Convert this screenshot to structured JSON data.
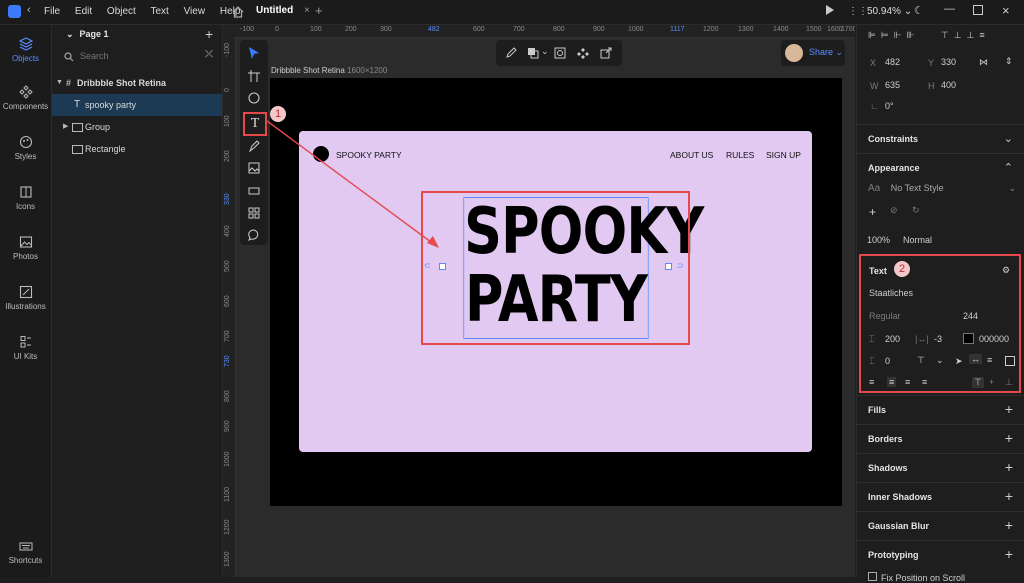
{
  "titlebar": {
    "menus": [
      "File",
      "Edit",
      "Object",
      "Text",
      "View",
      "Help"
    ],
    "tab_title": "Untitled",
    "zoom": "50.94%"
  },
  "rail": {
    "items": [
      {
        "label": "Objects",
        "icon": "layers-icon"
      },
      {
        "label": "Components",
        "icon": "components-icon"
      },
      {
        "label": "Styles",
        "icon": "styles-icon"
      },
      {
        "label": "Icons",
        "icon": "icons-icon"
      },
      {
        "label": "Photos",
        "icon": "photos-icon"
      },
      {
        "label": "Illustrations",
        "icon": "illustrations-icon"
      },
      {
        "label": "UI Kits",
        "icon": "ui-kits-icon"
      }
    ],
    "shortcuts_label": "Shortcuts"
  },
  "layers": {
    "page": "Page 1",
    "search_placeholder": "Search",
    "items": [
      "Dribbble Shot Retina",
      "spooky party",
      "Group",
      "Rectangle"
    ]
  },
  "canvas": {
    "ruler_top": [
      "-100",
      "0",
      "100",
      "200",
      "300",
      "482",
      "600",
      "700",
      "800",
      "900",
      "1000",
      "1117",
      "1200",
      "1300",
      "1400",
      "1500",
      "1600",
      "1700"
    ],
    "ruler_left": [
      "-100",
      "0",
      "100",
      "200",
      "330",
      "400",
      "500",
      "600",
      "700",
      "730",
      "800",
      "900",
      "1000",
      "1100",
      "1200",
      "1300"
    ],
    "frame_title": "Dribbble Shot Retina",
    "frame_size": "1600×1200",
    "share_label": "Share",
    "artboard": {
      "logo_text": "SPOOKY PARTY",
      "nav": [
        "ABOUT US",
        "RULES",
        "SIGN UP"
      ],
      "headline_line1": "SPOOKY",
      "headline_line2": "PARTY"
    },
    "badge1": "1",
    "badge2": "2"
  },
  "inspector": {
    "x_label": "X",
    "x_value": "482",
    "y_label": "Y",
    "y_value": "330",
    "w_label": "W",
    "w_value": "635",
    "h_label": "H",
    "h_value": "400",
    "rotation": "0°",
    "constraints": "Constraints",
    "appearance": "Appearance",
    "text_style": "No Text Style",
    "opacity": "100%",
    "blend": "Normal",
    "text_section": "Text",
    "font_family": "Staatliches",
    "font_weight": "Regular",
    "font_size": "244",
    "line_height": "200",
    "letter_spacing": "-3",
    "color_hex": "000000",
    "paragraph_spacing": "0",
    "sections": [
      "Fills",
      "Borders",
      "Shadows",
      "Inner Shadows",
      "Gaussian Blur",
      "Prototyping"
    ],
    "fix_position": "Fix Position on Scroll"
  },
  "colors": {
    "accent": "#3d7bfd",
    "annotation_red": "#e5484d",
    "artboard_bg": "#e2c9f2"
  }
}
